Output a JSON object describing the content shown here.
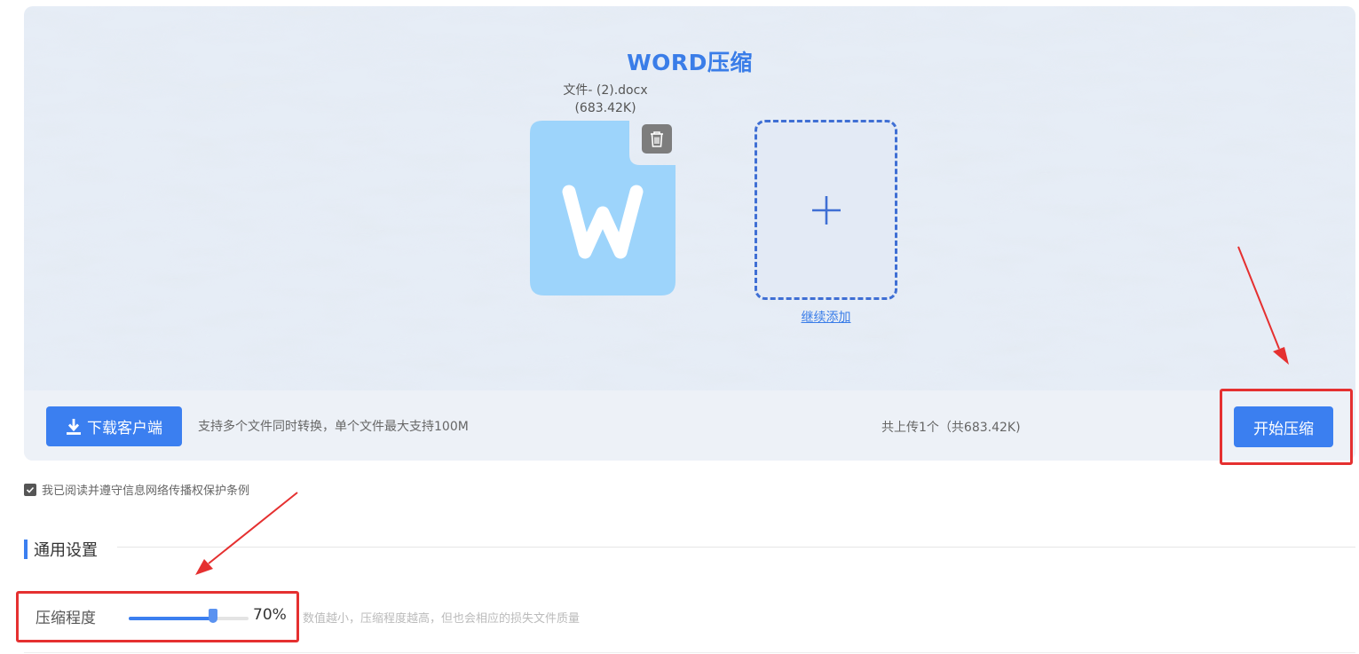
{
  "panel": {
    "title": "WORD压缩",
    "file": {
      "name": "文件- (2).docx",
      "size": "(683.42K)",
      "icon": "word-doc-icon"
    },
    "add_label": "继续添加"
  },
  "bottom_bar": {
    "download_label": "下载客户端",
    "support_text": "支持多个文件同时转换，单个文件最大支持100M",
    "upload_count": "共上传1个（共683.42K)",
    "start_label": "开始压缩"
  },
  "agreement": {
    "label": "我已阅读并遵守信息网络传播权保护条例",
    "checked": true
  },
  "settings": {
    "section_title": "通用设置",
    "compression_label": "压缩程度",
    "compression_value": 0.7,
    "compression_value_text": "70%",
    "hint": "数值越小，压缩程度越高，但也会相应的损失文件质量"
  },
  "colors": {
    "accent": "#3b7ff0",
    "highlight": "#e53030",
    "file_icon": "#9dd4fb"
  }
}
